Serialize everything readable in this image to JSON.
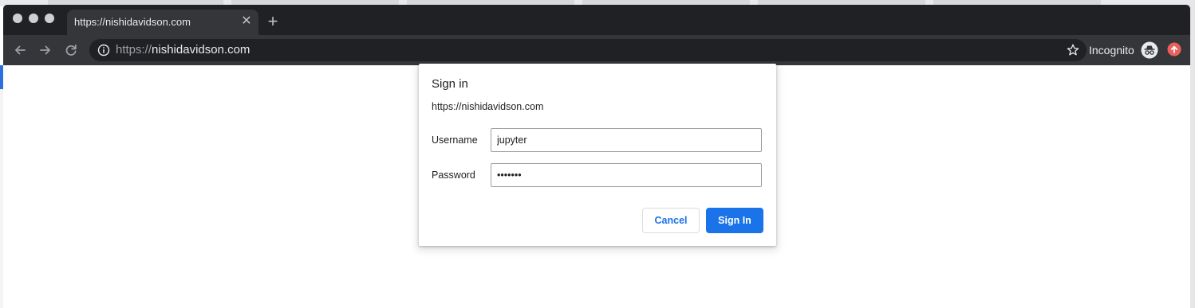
{
  "tab": {
    "title": "https://nishidavidson.com",
    "close_glyph": "✕",
    "new_tab_glyph": "+"
  },
  "omnibox": {
    "scheme": "https://",
    "host": "nishidavidson.com"
  },
  "profile": {
    "label": "Incognito"
  },
  "dialog": {
    "title": "Sign in",
    "origin": "https://nishidavidson.com",
    "username_label": "Username",
    "username_value": "jupyter",
    "password_label": "Password",
    "password_value": "•••••••",
    "cancel_label": "Cancel",
    "signin_label": "Sign In"
  },
  "colors": {
    "tabstrip_bg": "#202124",
    "toolbar_bg": "#35363a",
    "accent": "#1a73e8",
    "update_badge": "#e8625b"
  },
  "icons": [
    "back-arrow-icon",
    "forward-arrow-icon",
    "reload-icon",
    "info-icon",
    "star-icon",
    "incognito-icon",
    "update-icon",
    "close-icon",
    "plus-icon"
  ]
}
